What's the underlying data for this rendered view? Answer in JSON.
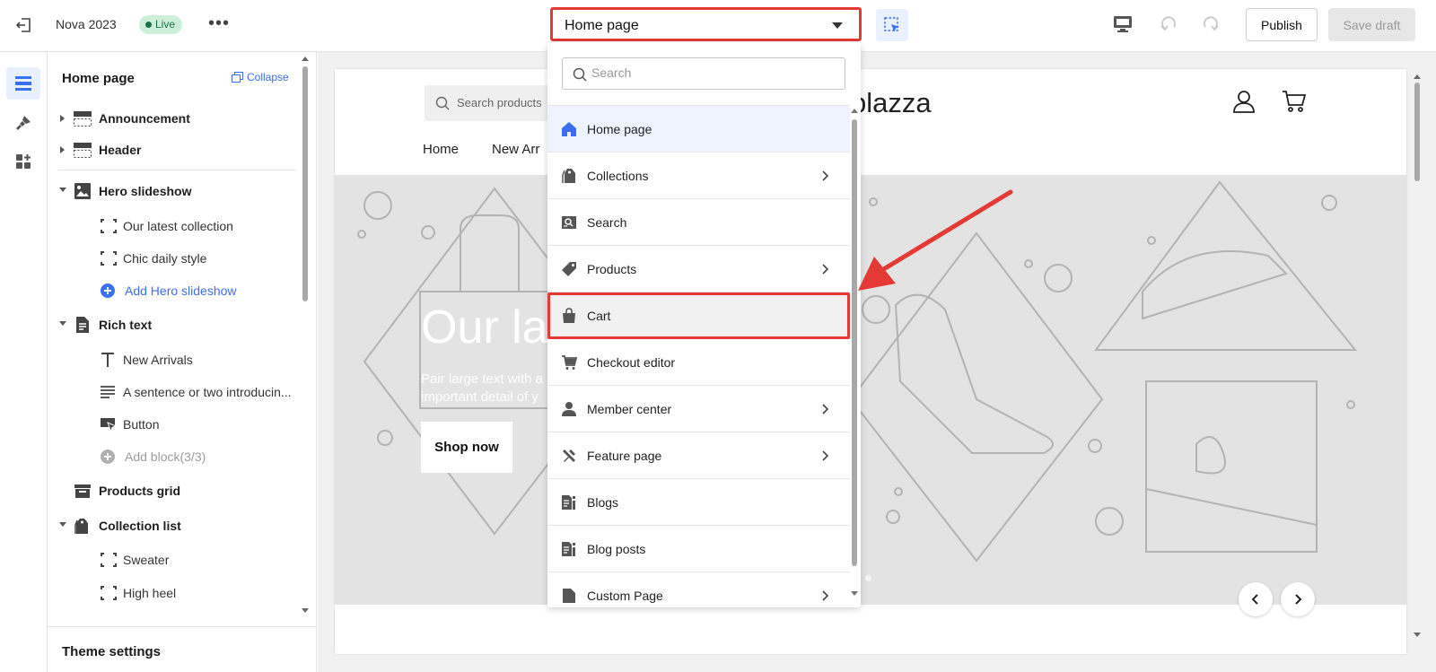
{
  "topbar": {
    "store_name": "Nova 2023",
    "status_badge": "Live",
    "page_selector": "Home page",
    "publish_label": "Publish",
    "save_draft_label": "Save draft"
  },
  "sidebar": {
    "title": "Home page",
    "collapse_label": "Collapse",
    "items": [
      {
        "label": "Announcement"
      },
      {
        "label": "Header"
      },
      {
        "label": "Hero slideshow"
      },
      {
        "label": "Our latest collection"
      },
      {
        "label": "Chic daily style"
      },
      {
        "label": "Add Hero slideshow"
      },
      {
        "label": "Rich text"
      },
      {
        "label": "New Arrivals"
      },
      {
        "label": "A sentence or two introducin..."
      },
      {
        "label": "Button"
      },
      {
        "label": "Add block(3/3)"
      },
      {
        "label": "Products grid"
      },
      {
        "label": "Collection list"
      },
      {
        "label": "Sweater"
      },
      {
        "label": "High heel"
      }
    ],
    "footer": "Theme settings"
  },
  "preview": {
    "search_placeholder": "Search products",
    "logo_text": "plazza",
    "nav": [
      "Home",
      "New Arr"
    ],
    "hero_title": "Our la",
    "hero_subtitle": "Pair large text with a\nimportant detail of y",
    "hero_button": "Shop now"
  },
  "dropdown": {
    "search_placeholder": "Search",
    "items": [
      {
        "label": "Home page",
        "icon": "home-icon",
        "submenu": false,
        "selected": true
      },
      {
        "label": "Collections",
        "icon": "collections-icon",
        "submenu": true
      },
      {
        "label": "Search",
        "icon": "search-page-icon",
        "submenu": false
      },
      {
        "label": "Products",
        "icon": "tag-icon",
        "submenu": true
      },
      {
        "label": "Cart",
        "icon": "bag-icon",
        "submenu": false,
        "highlighted": true
      },
      {
        "label": "Checkout editor",
        "icon": "cart-icon",
        "submenu": false
      },
      {
        "label": "Member center",
        "icon": "person-icon",
        "submenu": true
      },
      {
        "label": "Feature page",
        "icon": "tools-icon",
        "submenu": true
      },
      {
        "label": "Blogs",
        "icon": "blog-icon",
        "submenu": false
      },
      {
        "label": "Blog posts",
        "icon": "blog-post-icon",
        "submenu": false
      },
      {
        "label": "Custom Page",
        "icon": "page-icon",
        "submenu": true
      }
    ]
  },
  "colors": {
    "accent": "#3a6ff2",
    "annotation_red": "#e53935",
    "live_badge_bg": "#cdefd9",
    "live_badge_text": "#19704a"
  }
}
